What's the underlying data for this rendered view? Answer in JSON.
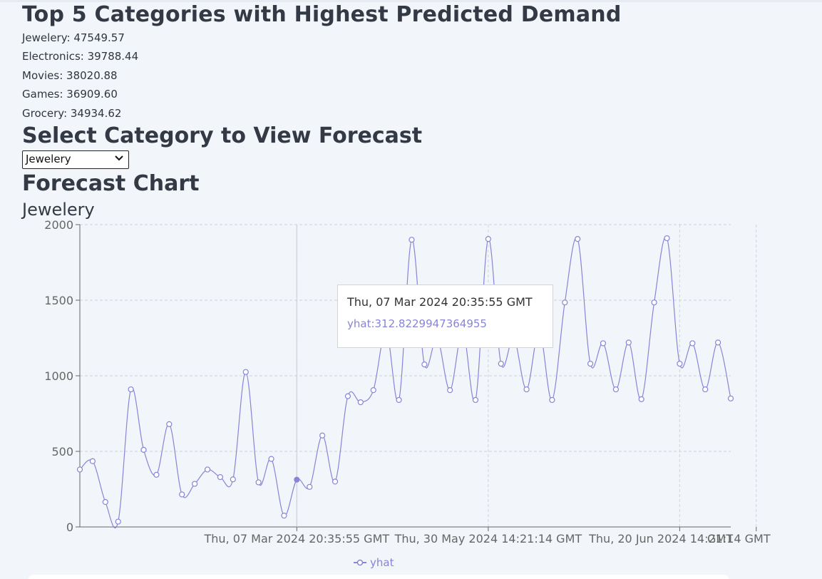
{
  "header": {
    "top_title": "Top 5 Categories with Highest Predicted Demand",
    "top_items": [
      "Jewelery: 47549.57",
      "Electronics: 39788.44",
      "Movies: 38020.88",
      "Games: 36909.60",
      "Grocery: 34934.62"
    ]
  },
  "select_section": {
    "title": "Select Category to View Forecast",
    "selected": "Jewelery"
  },
  "forecast": {
    "title": "Forecast Chart",
    "chart_title": "Jewelery"
  },
  "tooltip": {
    "label": "Thu, 07 Mar 2024 20:35:55 GMT",
    "value_text": "yhat:312.8229947364955"
  },
  "chart_data": {
    "type": "line",
    "title": "Jewelery",
    "series": [
      {
        "name": "yhat",
        "color": "#8884d8",
        "values": [
          380,
          435,
          165,
          35,
          910,
          510,
          345,
          680,
          215,
          285,
          380,
          330,
          315,
          1025,
          295,
          450,
          75,
          312.82,
          265,
          605,
          300,
          865,
          825,
          905,
          1300,
          840,
          1900,
          1075,
          1250,
          905,
          1300,
          840,
          1905,
          1080,
          1250,
          910,
          1300,
          840,
          1485,
          1905,
          1080,
          1215,
          910,
          1220,
          845,
          1485,
          1910,
          1080,
          1215,
          910,
          1220,
          850
        ]
      }
    ],
    "x_tick_labels": [
      {
        "index": 17,
        "label": "Thu, 07 Mar 2024 20:35:55 GMT"
      },
      {
        "index": 32,
        "label": "Thu, 30 May 2024 14:21:14 GMT"
      },
      {
        "index": 47,
        "label": "Thu, 20 Jun 2024 14:21:14 GMT"
      },
      {
        "index": 53,
        "label": "GMT"
      }
    ],
    "ylim": [
      0,
      2000
    ],
    "y_ticks": [
      0,
      500,
      1000,
      1500,
      2000
    ],
    "grid": true,
    "active_index": 17,
    "legend": {
      "position": "bottom",
      "label": "yhat"
    }
  }
}
